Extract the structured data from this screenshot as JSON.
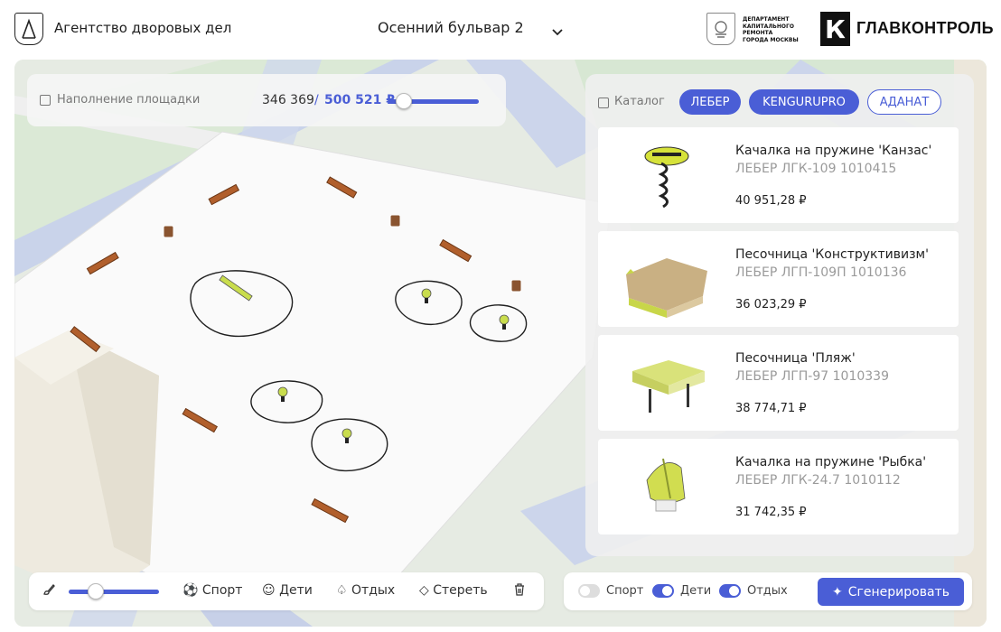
{
  "header": {
    "agency": "Агентство дворовых дел",
    "address": "Осенний бульвар 2",
    "department": [
      "ДЕПАРТАМЕНТ",
      "КАПИТАЛЬНОГО РЕМОНТА",
      "ГОРОДА МОСКВЫ"
    ],
    "gk_letter": "К",
    "gk_name": "ГЛАВКОНТРОЛЬ"
  },
  "fill": {
    "label": "Наполнение площадки",
    "current": "346 369",
    "separator": "/",
    "total": "500 521 ₽",
    "slider_fraction": 0.69
  },
  "catalog": {
    "label": "Каталог",
    "chips": [
      {
        "label": "ЛЕБЕР",
        "active": true
      },
      {
        "label": "KENGURUPRO",
        "active": true
      },
      {
        "label": "АДАНАТ",
        "active": false
      }
    ],
    "items": [
      {
        "name": "Качалка на пружине 'Канзас'",
        "code": "ЛЕБЕР ЛГК-109 1010415",
        "price": "40 951,28 ₽",
        "icon": "spring-rocker-image"
      },
      {
        "name": "Песочница 'Конструктивизм'",
        "code": "ЛЕБЕР ЛГП-109П 1010136",
        "price": "36 023,29 ₽",
        "icon": "sandbox-image"
      },
      {
        "name": "Песочница 'Пляж'",
        "code": "ЛЕБЕР ЛГП-97 1010339",
        "price": "38 774,71 ₽",
        "icon": "sandbox-roof-image"
      },
      {
        "name": "Качалка на пружине 'Рыбка'",
        "code": "ЛЕБЕР ЛГК-24.7 1010112",
        "price": "31 742,35 ₽",
        "icon": "fish-rocker-image"
      }
    ]
  },
  "tools": {
    "brush_fraction": 0.3,
    "sport": "Спорт",
    "kids": "Дети",
    "rest": "Отдых",
    "erase": "Стереть"
  },
  "filters": {
    "sport": {
      "label": "Спорт",
      "on": false
    },
    "kids": {
      "label": "Дети",
      "on": true
    },
    "rest": {
      "label": "Отдых",
      "on": true
    },
    "generate": "Сгенерировать"
  },
  "colors": {
    "accent": "#4a5ed6"
  }
}
